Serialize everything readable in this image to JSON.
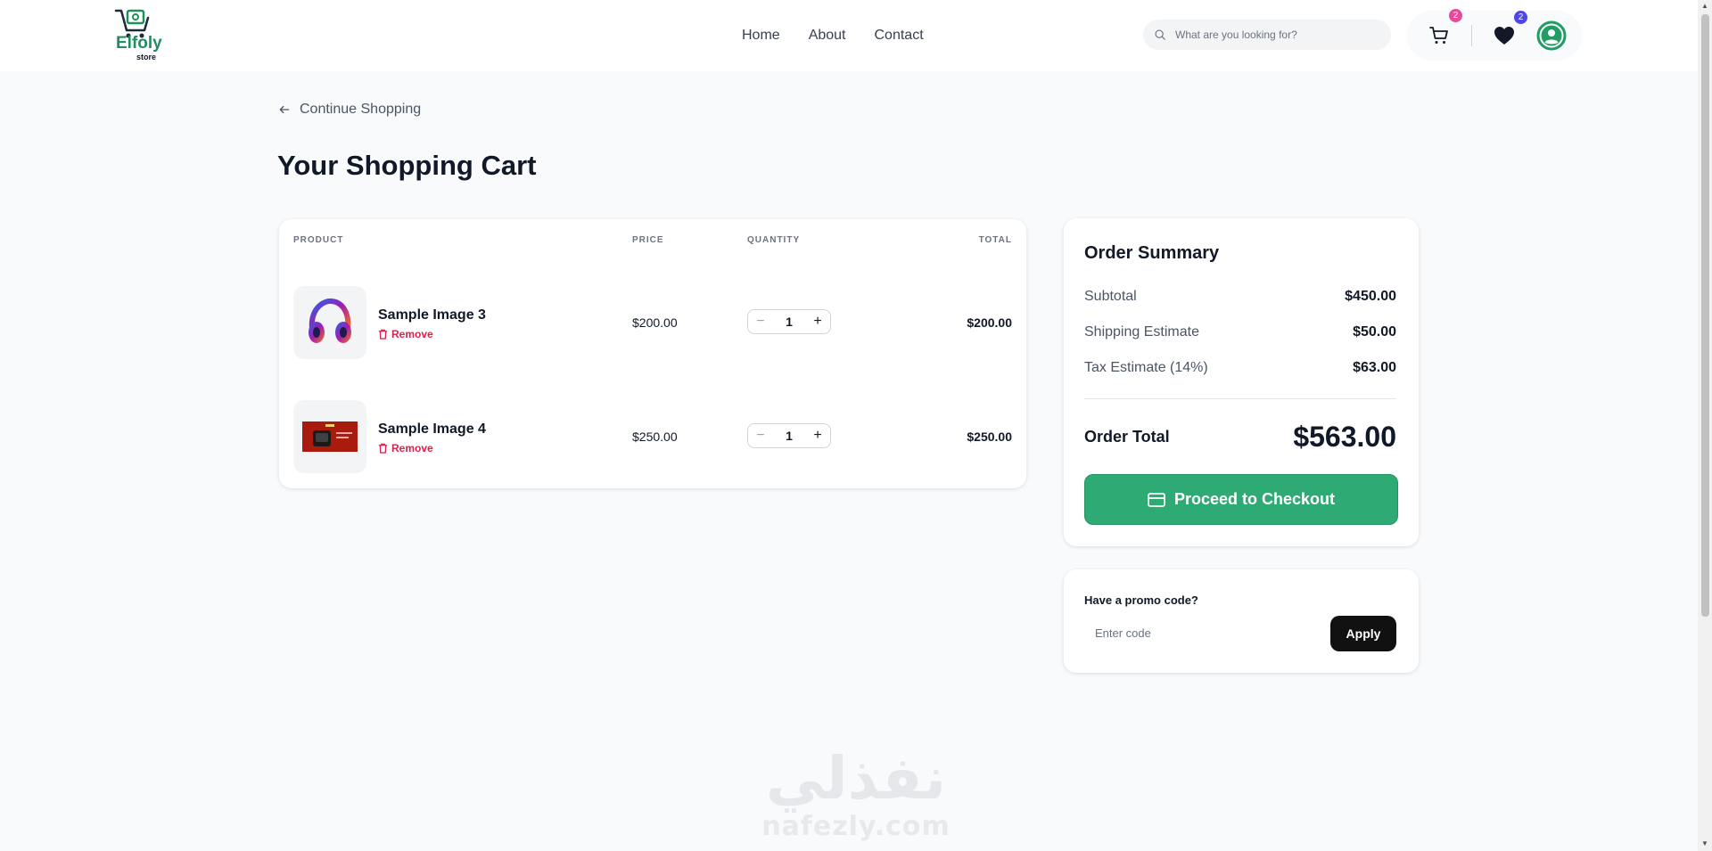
{
  "brand": {
    "name": "Elfoly",
    "sub": "store"
  },
  "nav": {
    "home": "Home",
    "about": "About",
    "contact": "Contact"
  },
  "search": {
    "placeholder": "What are you looking for?"
  },
  "header_icons": {
    "cart_count": "2",
    "wishlist_count": "2"
  },
  "back_link": "Continue Shopping",
  "page_title": "Your Shopping Cart",
  "cart": {
    "columns": {
      "product": "PRODUCT",
      "price": "PRICE",
      "quantity": "QUANTITY",
      "total": "TOTAL"
    },
    "items": [
      {
        "name": "Sample Image 3",
        "remove": "Remove",
        "price": "$200.00",
        "quantity": "1",
        "total": "$200.00"
      },
      {
        "name": "Sample Image 4",
        "remove": "Remove",
        "price": "$250.00",
        "quantity": "1",
        "total": "$250.00"
      }
    ]
  },
  "summary": {
    "title": "Order Summary",
    "subtotal_label": "Subtotal",
    "subtotal": "$450.00",
    "shipping_label": "Shipping Estimate",
    "shipping": "$50.00",
    "tax_label": "Tax Estimate (14%)",
    "tax": "$63.00",
    "total_label": "Order Total",
    "total": "$563.00",
    "checkout_label": "Proceed to Checkout"
  },
  "promo": {
    "label": "Have a promo code?",
    "placeholder": "Enter code",
    "apply": "Apply"
  },
  "watermark": {
    "arabic": "نفذلي",
    "latin": "nafezly.com"
  },
  "colors": {
    "accent_green": "#2eaa74",
    "remove_red": "#e11d48",
    "cart_badge": "#ec4899",
    "wishlist_badge": "#4f46e5",
    "dark": "#111111"
  }
}
